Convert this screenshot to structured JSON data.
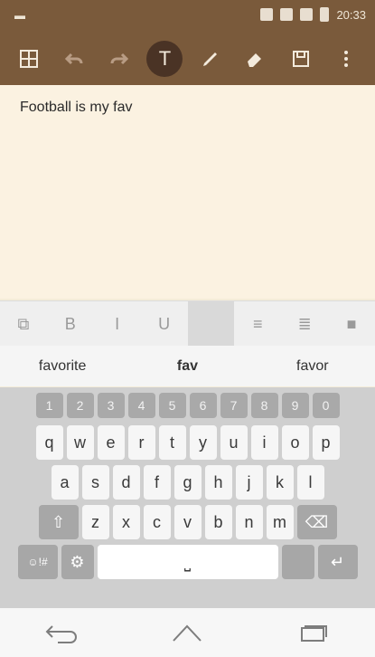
{
  "status": {
    "time": "20:33"
  },
  "toolbar": {
    "buttons": [
      {
        "name": "grid-icon"
      },
      {
        "name": "undo-icon"
      },
      {
        "name": "redo-icon"
      },
      {
        "name": "text-tool-icon",
        "label": "T"
      },
      {
        "name": "pen-icon"
      },
      {
        "name": "eraser-icon"
      },
      {
        "name": "save-icon"
      },
      {
        "name": "more-icon"
      }
    ]
  },
  "editor": {
    "text": "Football is my fav"
  },
  "formatbar": {
    "items": [
      {
        "name": "format-paint-icon",
        "label": "⧉"
      },
      {
        "name": "bold-button",
        "label": "B"
      },
      {
        "name": "italic-button",
        "label": "I"
      },
      {
        "name": "underline-button",
        "label": "U"
      },
      {
        "name": "text-color-button",
        "label": ""
      },
      {
        "name": "align-center-button",
        "label": "≡"
      },
      {
        "name": "align-right-button",
        "label": "≣"
      },
      {
        "name": "fill-button",
        "label": "■"
      }
    ]
  },
  "suggestions": [
    "favorite",
    "fav",
    "favor"
  ],
  "keyboard": {
    "number_row": [
      "1",
      "2",
      "3",
      "4",
      "5",
      "6",
      "7",
      "8",
      "9",
      "0"
    ],
    "row1": [
      "q",
      "w",
      "e",
      "r",
      "t",
      "y",
      "u",
      "i",
      "o",
      "p"
    ],
    "row2": [
      "a",
      "s",
      "d",
      "f",
      "g",
      "h",
      "j",
      "k",
      "l"
    ],
    "row3": [
      "z",
      "x",
      "c",
      "v",
      "b",
      "n",
      "m"
    ],
    "symbols_label": "☺!#"
  }
}
